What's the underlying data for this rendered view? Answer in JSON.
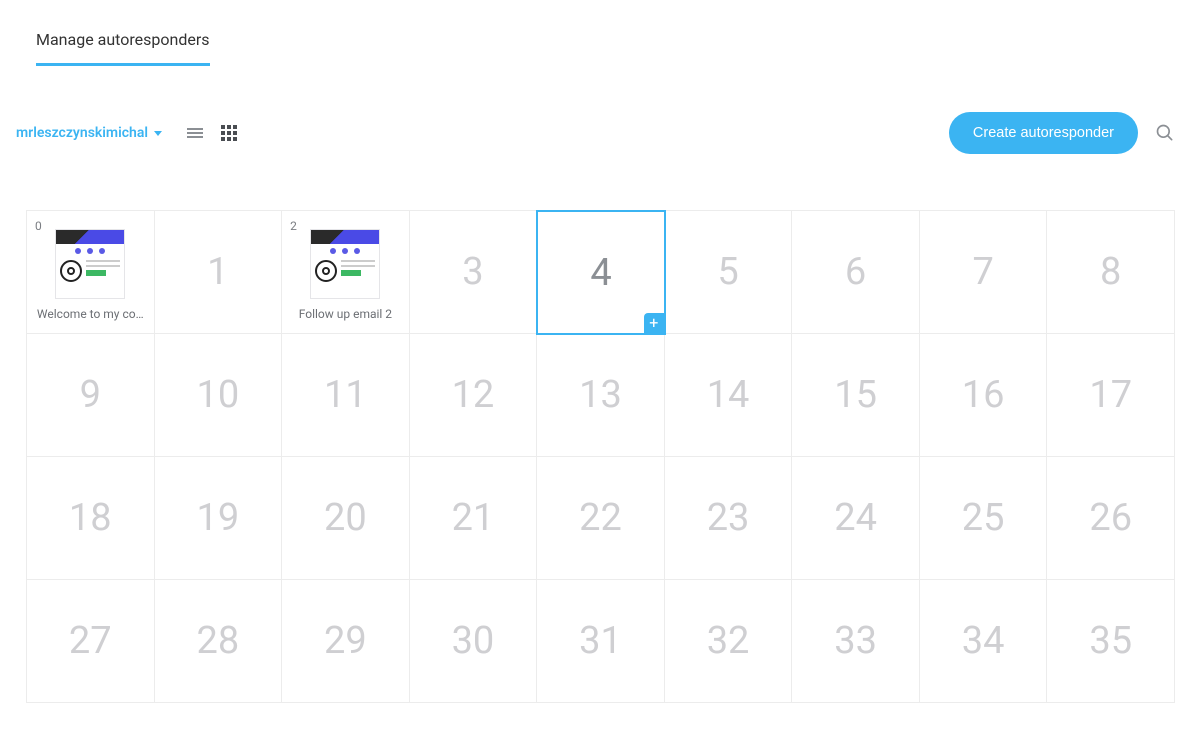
{
  "tabs": {
    "manage": "Manage autoresponders"
  },
  "toolbar": {
    "user": "mrleszczynskimichal",
    "create_label": "Create autoresponder"
  },
  "grid": {
    "selected_day": 4,
    "days": [
      0,
      1,
      2,
      3,
      4,
      5,
      6,
      7,
      8,
      9,
      10,
      11,
      12,
      13,
      14,
      15,
      16,
      17,
      18,
      19,
      20,
      21,
      22,
      23,
      24,
      25,
      26,
      27,
      28,
      29,
      30,
      31,
      32,
      33,
      34,
      35
    ],
    "emails": {
      "0": {
        "title": "Welcome to my co…"
      },
      "2": {
        "title": "Follow up email 2"
      }
    }
  }
}
